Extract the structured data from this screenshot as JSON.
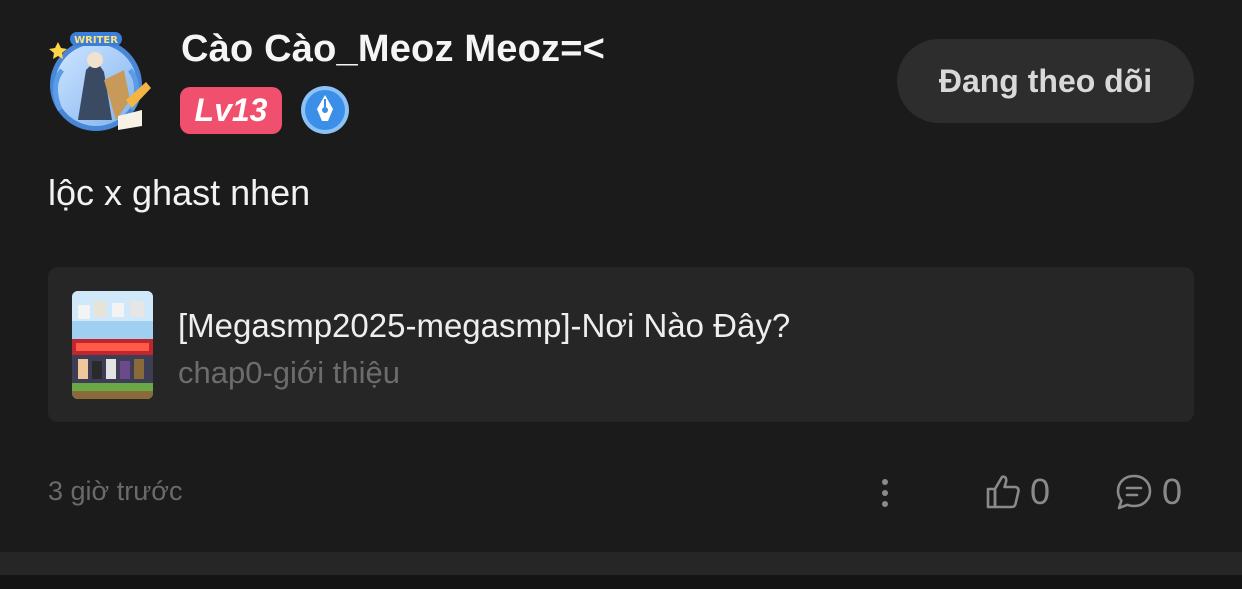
{
  "post": {
    "username": "Cào Cào_Meoz Meoz=<",
    "level": "Lv13",
    "follow_label": "Đang theo dõi",
    "text": "lộc x ghast nhen",
    "story": {
      "title": "[Megasmp2025-megasmp]-Nơi Nào Đây?",
      "chapter": "chap0-giới thiệu"
    },
    "timestamp": "3 giờ trước",
    "likes": "0",
    "comments": "0"
  },
  "icons": {
    "avatar_frame": "writer-avatar-frame",
    "badge": "writer-pen-badge",
    "more": "vertical-dots-icon",
    "like": "thumbs-up-icon",
    "comment": "comment-bubble-icon"
  },
  "colors": {
    "background": "#1b1b1b",
    "card": "#262626",
    "level_badge": "#f0506e",
    "follow_button": "#2d2d2d",
    "writer_badge": "#3b8fe8"
  }
}
